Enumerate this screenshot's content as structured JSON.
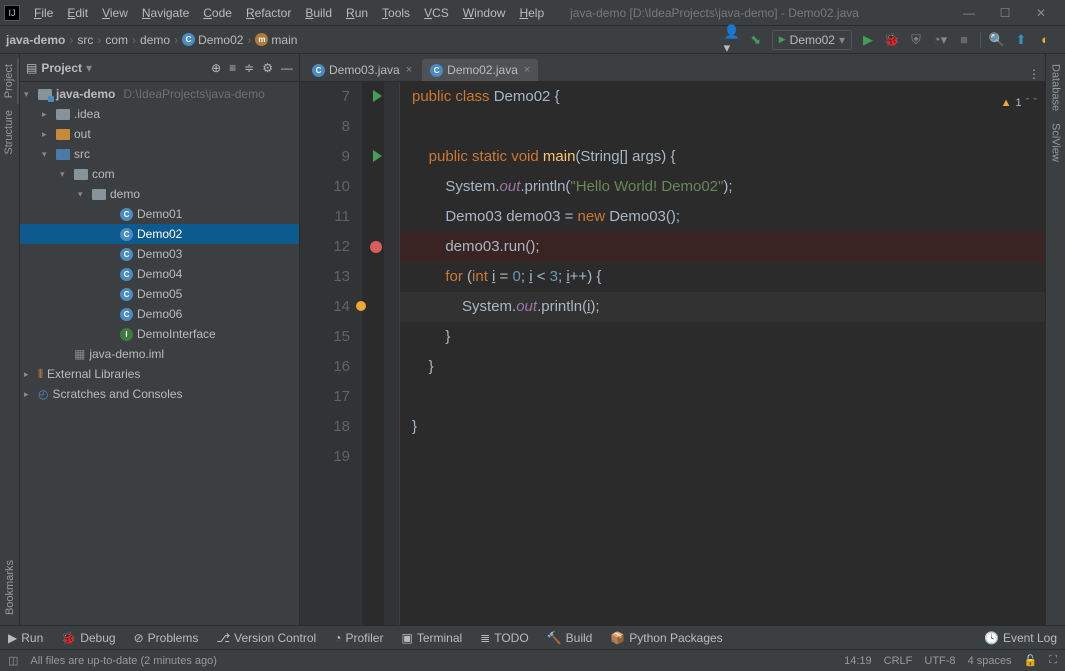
{
  "window": {
    "title": "java-demo [D:\\IdeaProjects\\java-demo] - Demo02.java"
  },
  "menu": [
    "File",
    "Edit",
    "View",
    "Navigate",
    "Code",
    "Refactor",
    "Build",
    "Run",
    "Tools",
    "VCS",
    "Window",
    "Help"
  ],
  "breadcrumb": {
    "project": "java-demo",
    "parts": [
      "src",
      "com",
      "demo"
    ],
    "class": "Demo02",
    "method": "main"
  },
  "runConfig": "Demo02",
  "leftTabs": {
    "project": "Project",
    "structure": "Structure",
    "bookmarks": "Bookmarks"
  },
  "projectPanel": {
    "title": "Project",
    "root": {
      "name": "java-demo",
      "path": "D:\\IdeaProjects\\java-demo"
    },
    "idea": ".idea",
    "out": "out",
    "src": "src",
    "com": "com",
    "demo": "demo",
    "files": [
      "Demo01",
      "Demo02",
      "Demo03",
      "Demo04",
      "Demo05",
      "Demo06",
      "DemoInterface"
    ],
    "iml": "java-demo.iml",
    "ext": "External Libraries",
    "scratch": "Scratches and Consoles"
  },
  "editorTabs": [
    {
      "name": "Demo03.java",
      "active": false
    },
    {
      "name": "Demo02.java",
      "active": true
    }
  ],
  "code": {
    "startLine": 7,
    "lines": [
      {
        "n": 7,
        "runMark": true,
        "html": "<span class='kw'>public class </span><span class='cls'>Demo02 {</span>"
      },
      {
        "n": 8,
        "html": ""
      },
      {
        "n": 9,
        "runMark": true,
        "html": "    <span class='kw'>public static void </span><span class='mtd'>main</span><span class='pl'>(String[] args) {</span>"
      },
      {
        "n": 10,
        "html": "        <span class='cls'>System</span><span class='pl'>.</span><span class='field'>out</span><span class='pl'>.println(</span><span class='str'>\"Hello World! Demo02\"</span><span class='pl'>);</span>"
      },
      {
        "n": 11,
        "html": "        <span class='cls'>Demo03 demo03 = </span><span class='kw'>new </span><span class='cls'>Demo03();</span>"
      },
      {
        "n": 12,
        "bp": true,
        "hl": "bp",
        "html": "        <span class='cls'>demo03.run();</span>"
      },
      {
        "n": 13,
        "html": "        <span class='kw'>for </span><span class='pl'>(</span><span class='kw'>int </span><span class='cls'><u>i</u> = </span><span class='num'>0</span><span class='pl'>; <u>i</u> &lt; </span><span class='num'>3</span><span class='pl'>; <u>i</u>++) {</span>"
      },
      {
        "n": 14,
        "bulb": true,
        "hl": "cur",
        "html": "            <span class='cls'>System</span><span class='pl'>.</span><span class='field'>out</span><span class='pl'>.println(<u>i</u>);</span>"
      },
      {
        "n": 15,
        "html": "        <span class='pl'>}</span>"
      },
      {
        "n": 16,
        "html": "    <span class='pl'>}</span>"
      },
      {
        "n": 17,
        "html": ""
      },
      {
        "n": 18,
        "html": "<span class='pl'>}</span>"
      },
      {
        "n": 19,
        "html": ""
      }
    ]
  },
  "inspection": {
    "warnings": 1
  },
  "rightTabs": {
    "database": "Database",
    "sciview": "SciView"
  },
  "bottomTools": [
    "Run",
    "Debug",
    "Problems",
    "Version Control",
    "Profiler",
    "Terminal",
    "TODO",
    "Build",
    "Python Packages"
  ],
  "bottomToolsIcons": [
    "▶",
    "🐞",
    "⊘",
    "⎇",
    "◔",
    "▣",
    "≣",
    "🔨",
    "📦"
  ],
  "eventLog": "Event Log",
  "status": {
    "msg": "All files are up-to-date (2 minutes ago)",
    "pos": "14:19",
    "sep": "CRLF",
    "enc": "UTF-8",
    "indent": "4 spaces"
  }
}
